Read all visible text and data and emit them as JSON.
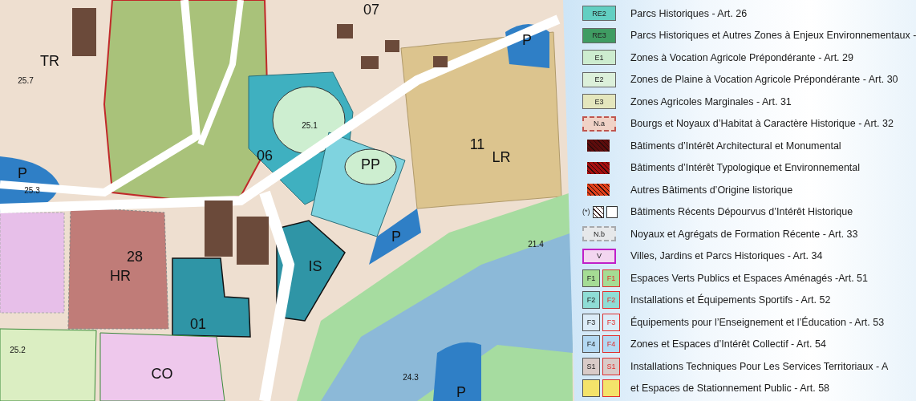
{
  "map": {
    "labels": [
      {
        "text": "TR",
        "kind": "zone"
      },
      {
        "text": "25.7",
        "kind": "elevation"
      },
      {
        "text": "P",
        "kind": "zone"
      },
      {
        "text": "25.3",
        "kind": "elevation"
      },
      {
        "text": "07",
        "kind": "zone"
      },
      {
        "text": "25.1",
        "kind": "elevation"
      },
      {
        "text": "06",
        "kind": "zone"
      },
      {
        "text": "PP",
        "kind": "zone"
      },
      {
        "text": "11",
        "kind": "zone"
      },
      {
        "text": "LR",
        "kind": "zone"
      },
      {
        "text": "P",
        "kind": "zone"
      },
      {
        "text": "P",
        "kind": "zone"
      },
      {
        "text": "28",
        "kind": "zone"
      },
      {
        "text": "HR",
        "kind": "zone"
      },
      {
        "text": "IS",
        "kind": "zone"
      },
      {
        "text": "01",
        "kind": "zone"
      },
      {
        "text": "21.4",
        "kind": "elevation"
      },
      {
        "text": "25.2",
        "kind": "elevation"
      },
      {
        "text": "CO",
        "kind": "zone"
      },
      {
        "text": "24.3",
        "kind": "elevation"
      },
      {
        "text": "P",
        "kind": "zone"
      }
    ]
  },
  "legend": [
    {
      "kind": "code",
      "code": "RE2",
      "color": "#62cfc2",
      "label": "Parcs Historiques - Art. 26"
    },
    {
      "kind": "code",
      "code": "RE3",
      "color": "#3f9c62",
      "label": "Parcs Historiques et Autres Zones à Enjeux Environnementaux -"
    },
    {
      "kind": "code",
      "code": "E1",
      "color": "#cdeccf",
      "label": "Zones à Vocation Agricole Prépondérante - Art. 29"
    },
    {
      "kind": "code",
      "code": "E2",
      "color": "#dcf0da",
      "label": "Zones de Plaine à Vocation Agricole Prépondérante - Art. 30"
    },
    {
      "kind": "code",
      "code": "E3",
      "color": "#e4e6bd",
      "label": "Zones Agricoles Marginales - Art. 31"
    },
    {
      "kind": "dashed",
      "code": "N.a",
      "color": "#f0d2c6",
      "label": "Bourgs et Noyaux d’Habitat à Caractère Historique - Art. 32"
    },
    {
      "kind": "hatch",
      "color": "#5c0c0c",
      "label": "Bâtiments d’Intérêt Architectural et Monumental"
    },
    {
      "kind": "hatch",
      "color": "#a50f0f",
      "label": "Bâtiments d’Intérêt Typologique et Environnemental"
    },
    {
      "kind": "hatch",
      "color": "#e0401a",
      "label": "Autres Bâtiments d’Origine listorique"
    },
    {
      "kind": "hatch-note",
      "note": "(*)",
      "color": "#ffffff",
      "label": "Bâtiments Récents Dépourvus d’Intérêt Historique"
    },
    {
      "kind": "dotted",
      "code": "N.b",
      "color": "#e6e8ea",
      "label": "Noyaux et Agrégats de Formation Récente - Art. 33"
    },
    {
      "kind": "framed",
      "code": "V",
      "color": "#f3d6f0",
      "label": "Villes, Jardins et Parcs Historiques - Art. 34"
    },
    {
      "kind": "pair",
      "codes": [
        "F1",
        "F1"
      ],
      "color": "#a5dc94",
      "label": "Espaces Verts Publics et Espaces Aménagés -Art. 51"
    },
    {
      "kind": "pair",
      "codes": [
        "F2",
        "F2"
      ],
      "color": "#8fddd5",
      "label": "Installations et Équipements Sportifs - Art. 52"
    },
    {
      "kind": "pair",
      "codes": [
        "F3",
        "F3"
      ],
      "color": "#dcecf8",
      "label": "Équipements pour l’Enseignement et l’Éducation - Art. 53"
    },
    {
      "kind": "pair",
      "codes": [
        "F4",
        "F4"
      ],
      "color": "#b3d8f2",
      "label": "Zones et Espaces d’Intérêt Collectif - Art. 54"
    },
    {
      "kind": "pair",
      "codes": [
        "S1",
        "S1"
      ],
      "color": "#d9cbc8",
      "label": "Installations Techniques Pour Les Services Territoriaux - A"
    },
    {
      "kind": "blank-pair",
      "color": "#f4e36a",
      "label": "et Espaces de Stationnement Public - Art. 58"
    }
  ]
}
